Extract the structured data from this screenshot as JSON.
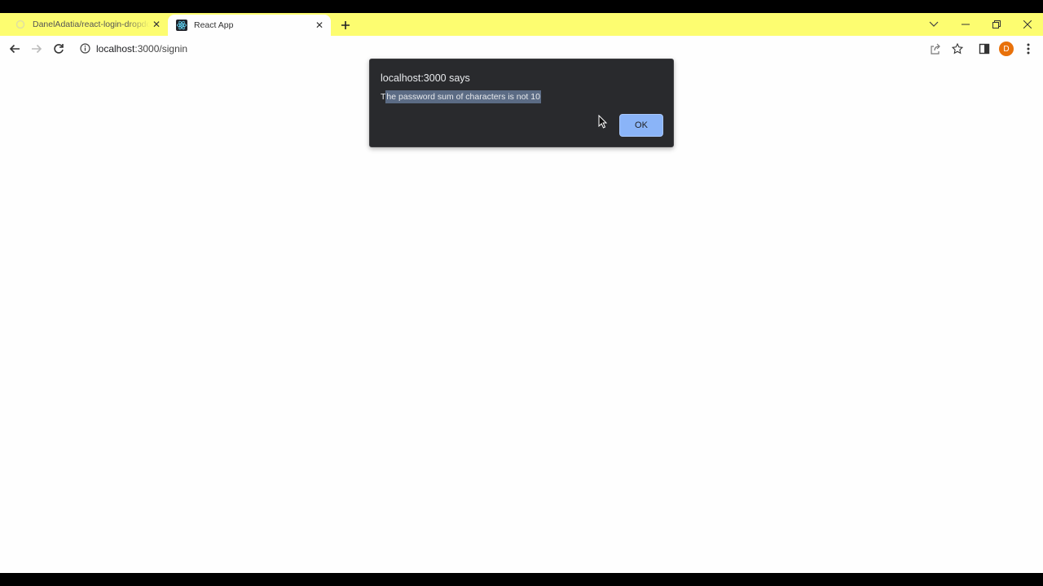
{
  "browser": {
    "tabs": [
      {
        "title": "DanelAdatia/react-login-dropdo",
        "active": false
      },
      {
        "title": "React App",
        "active": true
      }
    ],
    "address_bar": {
      "url_host": "localhost",
      "url_rest": ":3000/signin"
    },
    "profile_initial": "D"
  },
  "alert": {
    "title": "localhost:3000 says",
    "message_first_char": "T",
    "message_selected": "he password sum of characters is not 10",
    "ok_label": "OK"
  },
  "colors": {
    "tabstrip": "#fdfd70",
    "dialog_bg": "#292a2d",
    "ok_button": "#8ab4f8",
    "avatar": "#e8710a"
  }
}
